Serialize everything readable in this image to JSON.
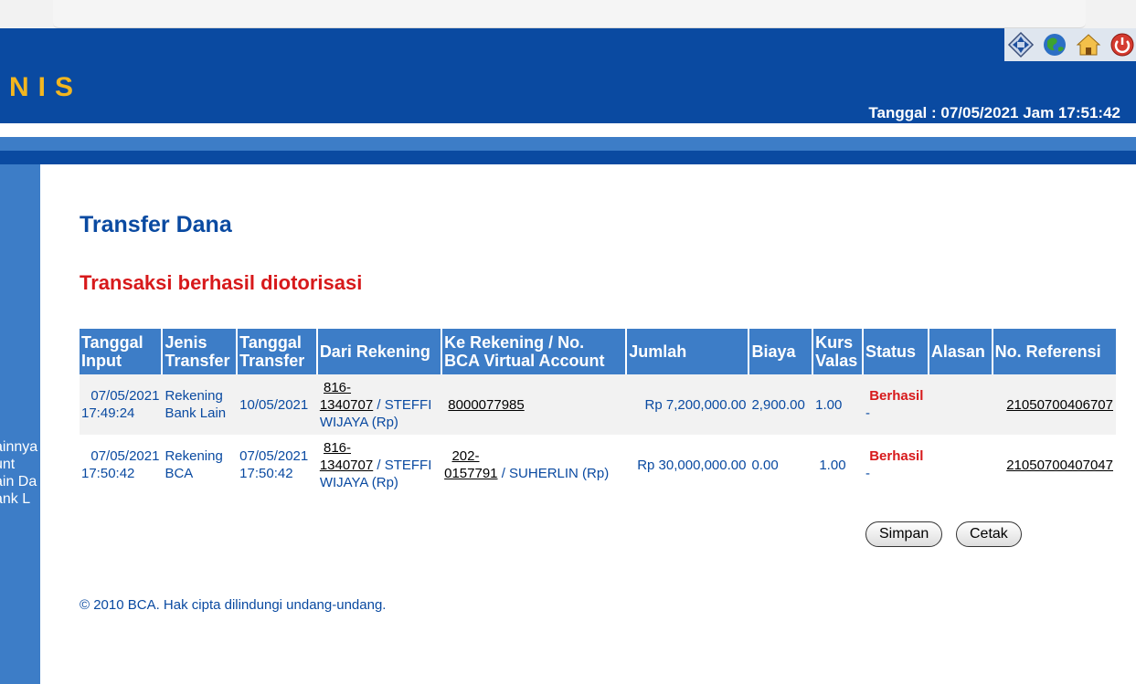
{
  "brand": {
    "logo_text": "NIS"
  },
  "header": {
    "date_text": "Tanggal : 07/05/2021 Jam 17:51:42"
  },
  "toolbar_icons": [
    "navigate-icon",
    "globe-icon",
    "home-icon",
    "power-icon"
  ],
  "sidebar": {
    "lines": [
      "ainnya",
      "unt",
      "ain Da",
      "ank L"
    ]
  },
  "page": {
    "title": "Transfer Dana",
    "message": "Transaksi berhasil diotorisasi"
  },
  "table": {
    "headers": [
      "Tanggal Input",
      "Jenis Transfer",
      "Tanggal Transfer",
      "Dari Rekening",
      "Ke Rekening / No. BCA Virtual Account",
      "Jumlah",
      "Biaya",
      "Kurs Valas",
      "Status",
      "Alasan",
      "No. Referensi"
    ],
    "rows": [
      {
        "input_date": "07/05/2021",
        "input_time": "17:49:24",
        "type": "Rekening Bank Lain",
        "transfer_date": "10/05/2021",
        "transfer_time": "",
        "from_prefix": "816-",
        "from_no": "1340707",
        "from_name": " / STEFFI WIJAYA (Rp)",
        "to_prefix": "",
        "to_no": "8000077985",
        "to_name": "",
        "amount": "Rp 7,200,000.00",
        "fee": "2,900.00",
        "rate": "1.00",
        "status": "Berhasil",
        "reason": "-",
        "ref": "21050700406707"
      },
      {
        "input_date": "07/05/2021",
        "input_time": "17:50:42",
        "type": "Rekening BCA",
        "transfer_date": "07/05/2021",
        "transfer_time": "17:50:42",
        "from_prefix": "816-",
        "from_no": "1340707",
        "from_name": " / STEFFI WIJAYA (Rp)",
        "to_prefix": "202-",
        "to_no": "0157791",
        "to_name": " / SUHERLIN (Rp)",
        "amount": "Rp 30,000,000.00",
        "fee": "0.00",
        "rate": "1.00",
        "status": "Berhasil",
        "reason": "-",
        "ref": "21050700407047"
      }
    ]
  },
  "buttons": {
    "save": "Simpan",
    "print": "Cetak"
  },
  "footer": {
    "copyright": "©  2010 BCA. Hak cipta dilindungi undang-undang."
  },
  "colors": {
    "primary": "#0a4aa1",
    "secondary": "#3d7dc7",
    "accent": "#d7191b",
    "logo": "#f3b61f"
  }
}
